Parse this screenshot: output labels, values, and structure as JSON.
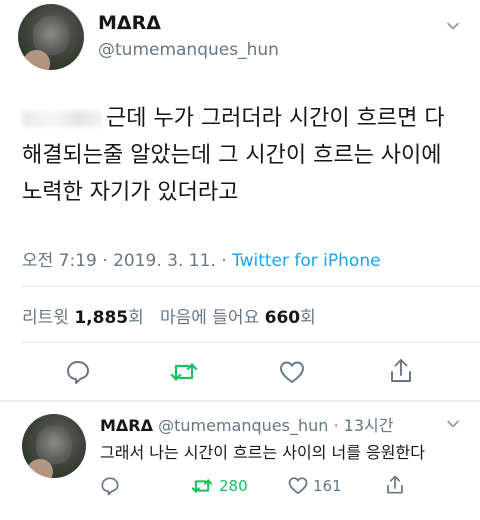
{
  "main_tweet": {
    "display_name": "MΔRΔ",
    "handle": "@tumemanques_hun",
    "text": "근데 누가 그러더라 시간이 흐르면 다 해결되는줄 알았는데 그 시간이 흐르는 사이에 노력한 자기가 있더라고",
    "meta": {
      "time": "오전 7:19 · 2019. 3. 11. · ",
      "source": "Twitter for iPhone"
    },
    "stats": {
      "retweets_label": "리트윗",
      "retweets_count": "1,885",
      "retweets_unit": "회",
      "likes_label": "마음에 들어요",
      "likes_count": "660",
      "likes_unit": "회"
    },
    "actions": {
      "reply_icon": "speech-bubble-icon",
      "retweet_icon": "retweet-icon",
      "like_icon": "heart-icon",
      "share_icon": "share-icon"
    }
  },
  "reply_tweet": {
    "display_name": "MΔRΔ",
    "handle_time": "@tumemanques_hun · 13시간",
    "text": "그래서 나는 시간이 흐르는 사이의 너를 응원한다",
    "actions": {
      "retweet_count": "280",
      "like_count": "161"
    }
  },
  "colors": {
    "accent": "#1da1f2",
    "retweet_green": "#17bf63",
    "secondary_text": "#657786",
    "divider": "#e1e8ed"
  }
}
